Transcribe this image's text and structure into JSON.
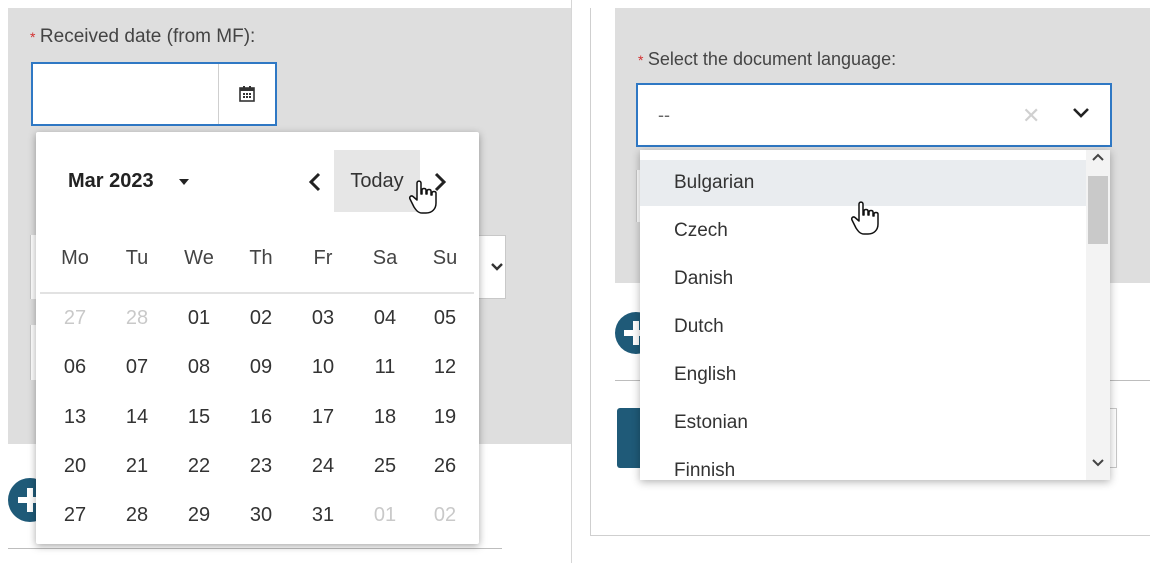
{
  "left": {
    "required_marker": "*",
    "label": "Received date (from MF):",
    "date_value": "",
    "calendar": {
      "month_label": "Mar 2023",
      "today_label": "Today",
      "weekdays": [
        "Mo",
        "Tu",
        "We",
        "Th",
        "Fr",
        "Sa",
        "Su"
      ],
      "weeks": [
        [
          {
            "d": "27",
            "muted": true
          },
          {
            "d": "28",
            "muted": true
          },
          {
            "d": "01"
          },
          {
            "d": "02"
          },
          {
            "d": "03"
          },
          {
            "d": "04"
          },
          {
            "d": "05"
          }
        ],
        [
          {
            "d": "06"
          },
          {
            "d": "07"
          },
          {
            "d": "08"
          },
          {
            "d": "09"
          },
          {
            "d": "10"
          },
          {
            "d": "11"
          },
          {
            "d": "12"
          }
        ],
        [
          {
            "d": "13"
          },
          {
            "d": "14"
          },
          {
            "d": "15"
          },
          {
            "d": "16"
          },
          {
            "d": "17"
          },
          {
            "d": "18"
          },
          {
            "d": "19"
          }
        ],
        [
          {
            "d": "20"
          },
          {
            "d": "21"
          },
          {
            "d": "22"
          },
          {
            "d": "23"
          },
          {
            "d": "24"
          },
          {
            "d": "25"
          },
          {
            "d": "26"
          }
        ],
        [
          {
            "d": "27"
          },
          {
            "d": "28"
          },
          {
            "d": "29"
          },
          {
            "d": "30"
          },
          {
            "d": "31"
          },
          {
            "d": "01",
            "muted": true
          },
          {
            "d": "02",
            "muted": true
          }
        ]
      ]
    }
  },
  "right": {
    "required_marker": "*",
    "label": "Select the document language:",
    "select_value": "--",
    "options": [
      "Bulgarian",
      "Czech",
      "Danish",
      "Dutch",
      "English",
      "Estonian",
      "Finnish"
    ],
    "hovered_option": "Bulgarian"
  },
  "icons": {
    "calendar": "calendar-icon",
    "caret": "caret-down-icon",
    "prev": "chevron-left-icon",
    "next": "chevron-right-icon",
    "clear": "close-icon",
    "dropdown": "chevron-down-icon",
    "cursor": "hand-pointer-icon"
  },
  "colors": {
    "focus_border": "#2f78c4",
    "required": "#d32f2f",
    "primary_button": "#1f5a78",
    "panel_bg": "#dedede",
    "hover_bg": "#e9ecef"
  }
}
